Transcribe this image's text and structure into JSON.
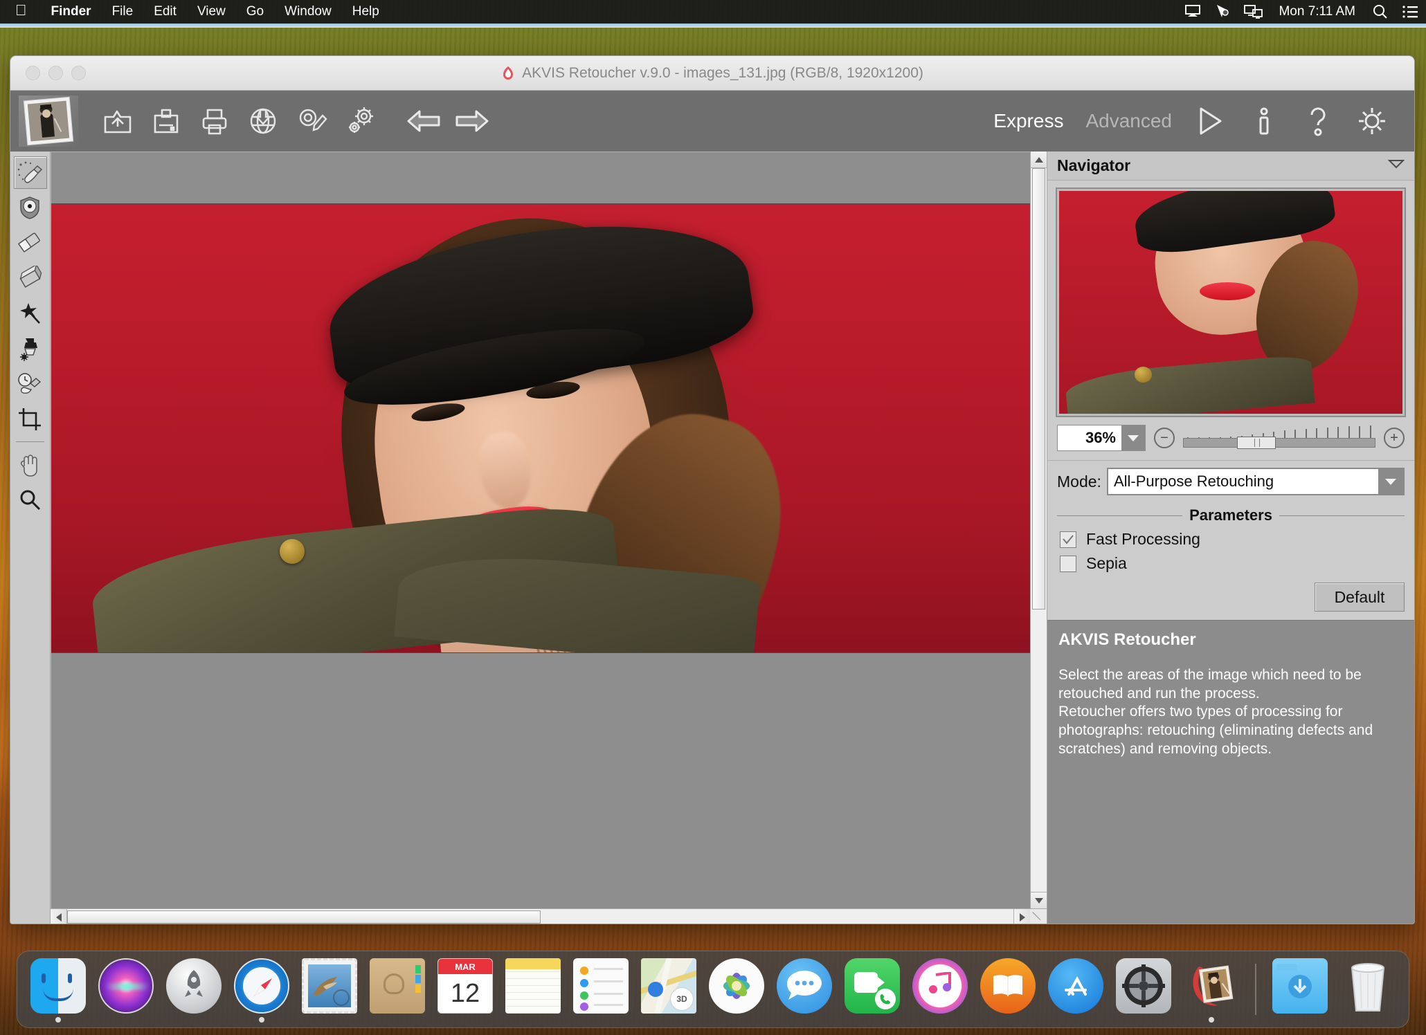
{
  "menubar": {
    "apple_icon": "apple-logo",
    "items": [
      {
        "label": "Finder",
        "bold": true
      },
      {
        "label": "File",
        "bold": false
      },
      {
        "label": "Edit",
        "bold": false
      },
      {
        "label": "View",
        "bold": false
      },
      {
        "label": "Go",
        "bold": false
      },
      {
        "label": "Window",
        "bold": false
      },
      {
        "label": "Help",
        "bold": false
      }
    ],
    "status_icons": [
      "airplay-display-icon",
      "cursor-pointer-icon",
      "screen-sharing-icon"
    ],
    "clock": "Mon 7:11 AM",
    "search_icon": "search-icon",
    "control_center_icon": "list-icon"
  },
  "window": {
    "title": "AKVIS Retoucher v.9.0 - images_131.jpg (RGB/8, 1920x1200)",
    "title_icon": "akvis-logo-icon",
    "controls": [
      "close-button",
      "minimize-button",
      "zoom-button"
    ]
  },
  "toolbar": {
    "logo": "akvis-retoucher-logo",
    "buttons": [
      {
        "name": "open-image-button",
        "icon": "open-folder-icon"
      },
      {
        "name": "save-image-button",
        "icon": "save-icon"
      },
      {
        "name": "print-image-button",
        "icon": "printer-icon"
      },
      {
        "name": "publish-web-button",
        "icon": "globe-download-icon"
      },
      {
        "name": "comments-button",
        "icon": "comment-pencil-icon"
      },
      {
        "name": "preferences-button",
        "icon": "gears-icon"
      },
      {
        "name": "undo-button",
        "icon": "arrow-left-icon"
      },
      {
        "name": "redo-button",
        "icon": "arrow-right-icon"
      }
    ],
    "tabs": [
      {
        "label": "Express",
        "active": true
      },
      {
        "label": "Advanced",
        "active": false
      }
    ],
    "right_buttons": [
      {
        "name": "run-button",
        "icon": "play-triangle-icon"
      },
      {
        "name": "about-button",
        "icon": "info-icon"
      },
      {
        "name": "help-button",
        "icon": "question-mark-icon"
      },
      {
        "name": "settings-button",
        "icon": "gear-icon"
      }
    ]
  },
  "tools": [
    {
      "name": "selection-brush-tool",
      "icon": "selection-brush-icon",
      "selected": true
    },
    {
      "name": "exclusion-brush-tool",
      "icon": "exclusion-shield-icon",
      "selected": false
    },
    {
      "name": "eraser-tool",
      "icon": "eraser-icon",
      "selected": false
    },
    {
      "name": "patch-tool",
      "icon": "patch-icon",
      "selected": false
    },
    {
      "name": "magic-wand-tool",
      "icon": "magic-wand-icon",
      "selected": false
    },
    {
      "name": "clone-stamp-tool",
      "icon": "clone-stamp-icon",
      "selected": false
    },
    {
      "name": "history-brush-tool",
      "icon": "history-brush-icon",
      "selected": false
    },
    {
      "name": "crop-tool",
      "icon": "crop-icon",
      "selected": false
    },
    {
      "name": "hand-tool",
      "icon": "hand-icon",
      "selected": false
    },
    {
      "name": "zoom-tool",
      "icon": "magnifier-icon",
      "selected": false
    }
  ],
  "navigator": {
    "title": "Navigator",
    "collapse_icon": "triangle-down-icon",
    "zoom_value": "36%",
    "zoom_dropdown_icon": "triangle-down-icon",
    "zoom_out_icon": "minus-circle-icon",
    "zoom_in_icon": "plus-circle-icon"
  },
  "settings": {
    "mode_label": "Mode:",
    "mode_value": "All-Purpose Retouching",
    "mode_dropdown_icon": "triangle-down-icon",
    "parameters_legend": "Parameters",
    "checkboxes": [
      {
        "label": "Fast Processing",
        "checked": true
      },
      {
        "label": "Sepia",
        "checked": false
      }
    ],
    "default_button": "Default"
  },
  "hints": {
    "title": "AKVIS Retoucher",
    "body": "Select the areas of the image which need to be retouched and run the process.\nRetoucher offers two types of processing for photographs: retouching (eliminating defects and scratches) and removing objects."
  },
  "dock": {
    "items": [
      {
        "name": "dock-item-finder",
        "label": "Finder",
        "running": true
      },
      {
        "name": "dock-item-siri",
        "label": "Siri",
        "running": false
      },
      {
        "name": "dock-item-launchpad",
        "label": "Launchpad",
        "running": false
      },
      {
        "name": "dock-item-safari",
        "label": "Safari",
        "running": true
      },
      {
        "name": "dock-item-mail",
        "label": "Mail",
        "running": false
      },
      {
        "name": "dock-item-contacts",
        "label": "Contacts",
        "running": false
      },
      {
        "name": "dock-item-calendar",
        "label": "Calendar",
        "running": false,
        "month": "MAR",
        "day": "12"
      },
      {
        "name": "dock-item-notes",
        "label": "Notes",
        "running": false
      },
      {
        "name": "dock-item-reminders",
        "label": "Reminders",
        "running": false
      },
      {
        "name": "dock-item-maps",
        "label": "Maps",
        "running": false,
        "badge": "3D"
      },
      {
        "name": "dock-item-photos",
        "label": "Photos",
        "running": false
      },
      {
        "name": "dock-item-messages",
        "label": "Messages",
        "running": false
      },
      {
        "name": "dock-item-facetime",
        "label": "FaceTime",
        "running": false
      },
      {
        "name": "dock-item-itunes",
        "label": "iTunes",
        "running": false
      },
      {
        "name": "dock-item-books",
        "label": "Books",
        "running": false
      },
      {
        "name": "dock-item-app-store",
        "label": "App Store",
        "running": false
      },
      {
        "name": "dock-item-system-preferences",
        "label": "System Preferences",
        "running": false
      },
      {
        "name": "dock-item-akvis-retoucher",
        "label": "AKVIS Retoucher",
        "running": true
      }
    ],
    "trailing": [
      {
        "name": "dock-item-downloads",
        "label": "Downloads"
      },
      {
        "name": "dock-item-trash",
        "label": "Trash"
      }
    ]
  }
}
